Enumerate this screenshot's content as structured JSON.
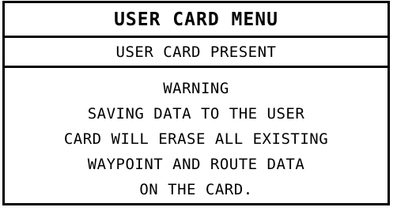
{
  "screen": {
    "title": "USER CARD MENU",
    "status": "USER CARD PRESENT",
    "message_lines": [
      "WARNING",
      "SAVING DATA TO THE USER",
      "CARD WILL ERASE ALL EXISTING",
      "WAYPOINT AND ROUTE DATA",
      "ON THE CARD."
    ]
  }
}
